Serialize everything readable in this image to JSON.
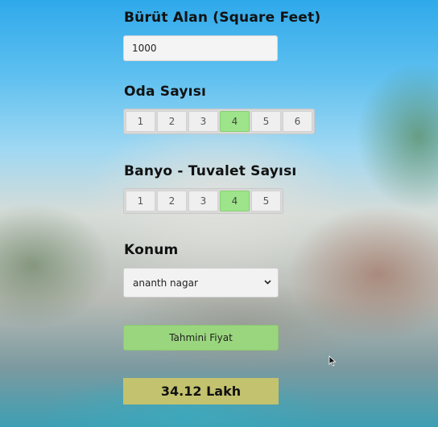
{
  "area": {
    "label": "Bürüt Alan (Square Feet)",
    "value": "1000"
  },
  "rooms": {
    "label": "Oda Sayısı",
    "options": [
      "1",
      "2",
      "3",
      "4",
      "5",
      "6"
    ],
    "selected": "4"
  },
  "baths": {
    "label": "Banyo - Tuvalet Sayısı",
    "options": [
      "1",
      "2",
      "3",
      "4",
      "5"
    ],
    "selected": "4"
  },
  "location": {
    "label": "Konum",
    "selected": "ananth nagar"
  },
  "estimate_button": {
    "label": "Tahmini Fiyat"
  },
  "result": {
    "text": "34.12 Lakh"
  },
  "colors": {
    "selected_option": "#9ee48a",
    "button": "#9ad67e",
    "result_bg": "#c3c26e"
  },
  "icons": {
    "select": "chevron-down-icon",
    "cursor": "mouse-pointer-icon"
  }
}
